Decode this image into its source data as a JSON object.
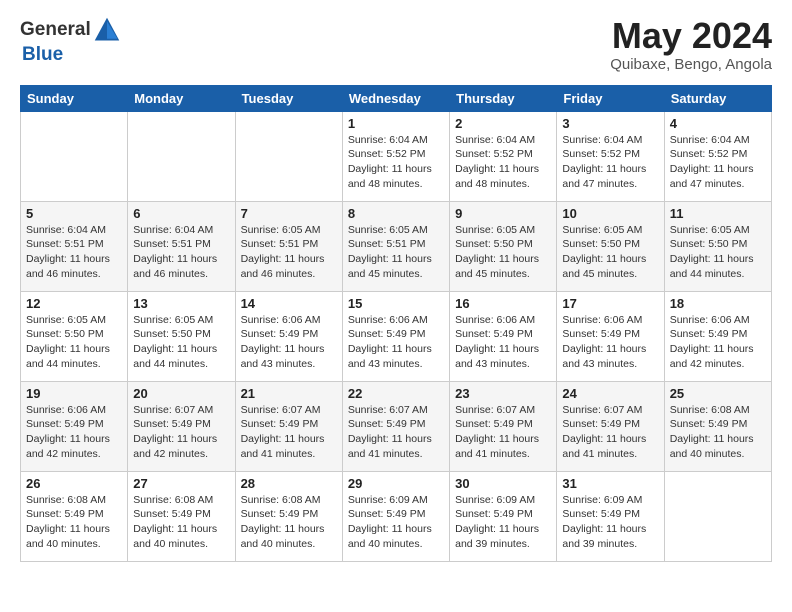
{
  "logo": {
    "text_general": "General",
    "text_blue": "Blue"
  },
  "title": "May 2024",
  "location": "Quibaxe, Bengo, Angola",
  "weekdays": [
    "Sunday",
    "Monday",
    "Tuesday",
    "Wednesday",
    "Thursday",
    "Friday",
    "Saturday"
  ],
  "weeks": [
    [
      {
        "day": "",
        "info": ""
      },
      {
        "day": "",
        "info": ""
      },
      {
        "day": "",
        "info": ""
      },
      {
        "day": "1",
        "info": "Sunrise: 6:04 AM\nSunset: 5:52 PM\nDaylight: 11 hours\nand 48 minutes."
      },
      {
        "day": "2",
        "info": "Sunrise: 6:04 AM\nSunset: 5:52 PM\nDaylight: 11 hours\nand 48 minutes."
      },
      {
        "day": "3",
        "info": "Sunrise: 6:04 AM\nSunset: 5:52 PM\nDaylight: 11 hours\nand 47 minutes."
      },
      {
        "day": "4",
        "info": "Sunrise: 6:04 AM\nSunset: 5:52 PM\nDaylight: 11 hours\nand 47 minutes."
      }
    ],
    [
      {
        "day": "5",
        "info": "Sunrise: 6:04 AM\nSunset: 5:51 PM\nDaylight: 11 hours\nand 46 minutes."
      },
      {
        "day": "6",
        "info": "Sunrise: 6:04 AM\nSunset: 5:51 PM\nDaylight: 11 hours\nand 46 minutes."
      },
      {
        "day": "7",
        "info": "Sunrise: 6:05 AM\nSunset: 5:51 PM\nDaylight: 11 hours\nand 46 minutes."
      },
      {
        "day": "8",
        "info": "Sunrise: 6:05 AM\nSunset: 5:51 PM\nDaylight: 11 hours\nand 45 minutes."
      },
      {
        "day": "9",
        "info": "Sunrise: 6:05 AM\nSunset: 5:50 PM\nDaylight: 11 hours\nand 45 minutes."
      },
      {
        "day": "10",
        "info": "Sunrise: 6:05 AM\nSunset: 5:50 PM\nDaylight: 11 hours\nand 45 minutes."
      },
      {
        "day": "11",
        "info": "Sunrise: 6:05 AM\nSunset: 5:50 PM\nDaylight: 11 hours\nand 44 minutes."
      }
    ],
    [
      {
        "day": "12",
        "info": "Sunrise: 6:05 AM\nSunset: 5:50 PM\nDaylight: 11 hours\nand 44 minutes."
      },
      {
        "day": "13",
        "info": "Sunrise: 6:05 AM\nSunset: 5:50 PM\nDaylight: 11 hours\nand 44 minutes."
      },
      {
        "day": "14",
        "info": "Sunrise: 6:06 AM\nSunset: 5:49 PM\nDaylight: 11 hours\nand 43 minutes."
      },
      {
        "day": "15",
        "info": "Sunrise: 6:06 AM\nSunset: 5:49 PM\nDaylight: 11 hours\nand 43 minutes."
      },
      {
        "day": "16",
        "info": "Sunrise: 6:06 AM\nSunset: 5:49 PM\nDaylight: 11 hours\nand 43 minutes."
      },
      {
        "day": "17",
        "info": "Sunrise: 6:06 AM\nSunset: 5:49 PM\nDaylight: 11 hours\nand 43 minutes."
      },
      {
        "day": "18",
        "info": "Sunrise: 6:06 AM\nSunset: 5:49 PM\nDaylight: 11 hours\nand 42 minutes."
      }
    ],
    [
      {
        "day": "19",
        "info": "Sunrise: 6:06 AM\nSunset: 5:49 PM\nDaylight: 11 hours\nand 42 minutes."
      },
      {
        "day": "20",
        "info": "Sunrise: 6:07 AM\nSunset: 5:49 PM\nDaylight: 11 hours\nand 42 minutes."
      },
      {
        "day": "21",
        "info": "Sunrise: 6:07 AM\nSunset: 5:49 PM\nDaylight: 11 hours\nand 41 minutes."
      },
      {
        "day": "22",
        "info": "Sunrise: 6:07 AM\nSunset: 5:49 PM\nDaylight: 11 hours\nand 41 minutes."
      },
      {
        "day": "23",
        "info": "Sunrise: 6:07 AM\nSunset: 5:49 PM\nDaylight: 11 hours\nand 41 minutes."
      },
      {
        "day": "24",
        "info": "Sunrise: 6:07 AM\nSunset: 5:49 PM\nDaylight: 11 hours\nand 41 minutes."
      },
      {
        "day": "25",
        "info": "Sunrise: 6:08 AM\nSunset: 5:49 PM\nDaylight: 11 hours\nand 40 minutes."
      }
    ],
    [
      {
        "day": "26",
        "info": "Sunrise: 6:08 AM\nSunset: 5:49 PM\nDaylight: 11 hours\nand 40 minutes."
      },
      {
        "day": "27",
        "info": "Sunrise: 6:08 AM\nSunset: 5:49 PM\nDaylight: 11 hours\nand 40 minutes."
      },
      {
        "day": "28",
        "info": "Sunrise: 6:08 AM\nSunset: 5:49 PM\nDaylight: 11 hours\nand 40 minutes."
      },
      {
        "day": "29",
        "info": "Sunrise: 6:09 AM\nSunset: 5:49 PM\nDaylight: 11 hours\nand 40 minutes."
      },
      {
        "day": "30",
        "info": "Sunrise: 6:09 AM\nSunset: 5:49 PM\nDaylight: 11 hours\nand 39 minutes."
      },
      {
        "day": "31",
        "info": "Sunrise: 6:09 AM\nSunset: 5:49 PM\nDaylight: 11 hours\nand 39 minutes."
      },
      {
        "day": "",
        "info": ""
      }
    ]
  ]
}
